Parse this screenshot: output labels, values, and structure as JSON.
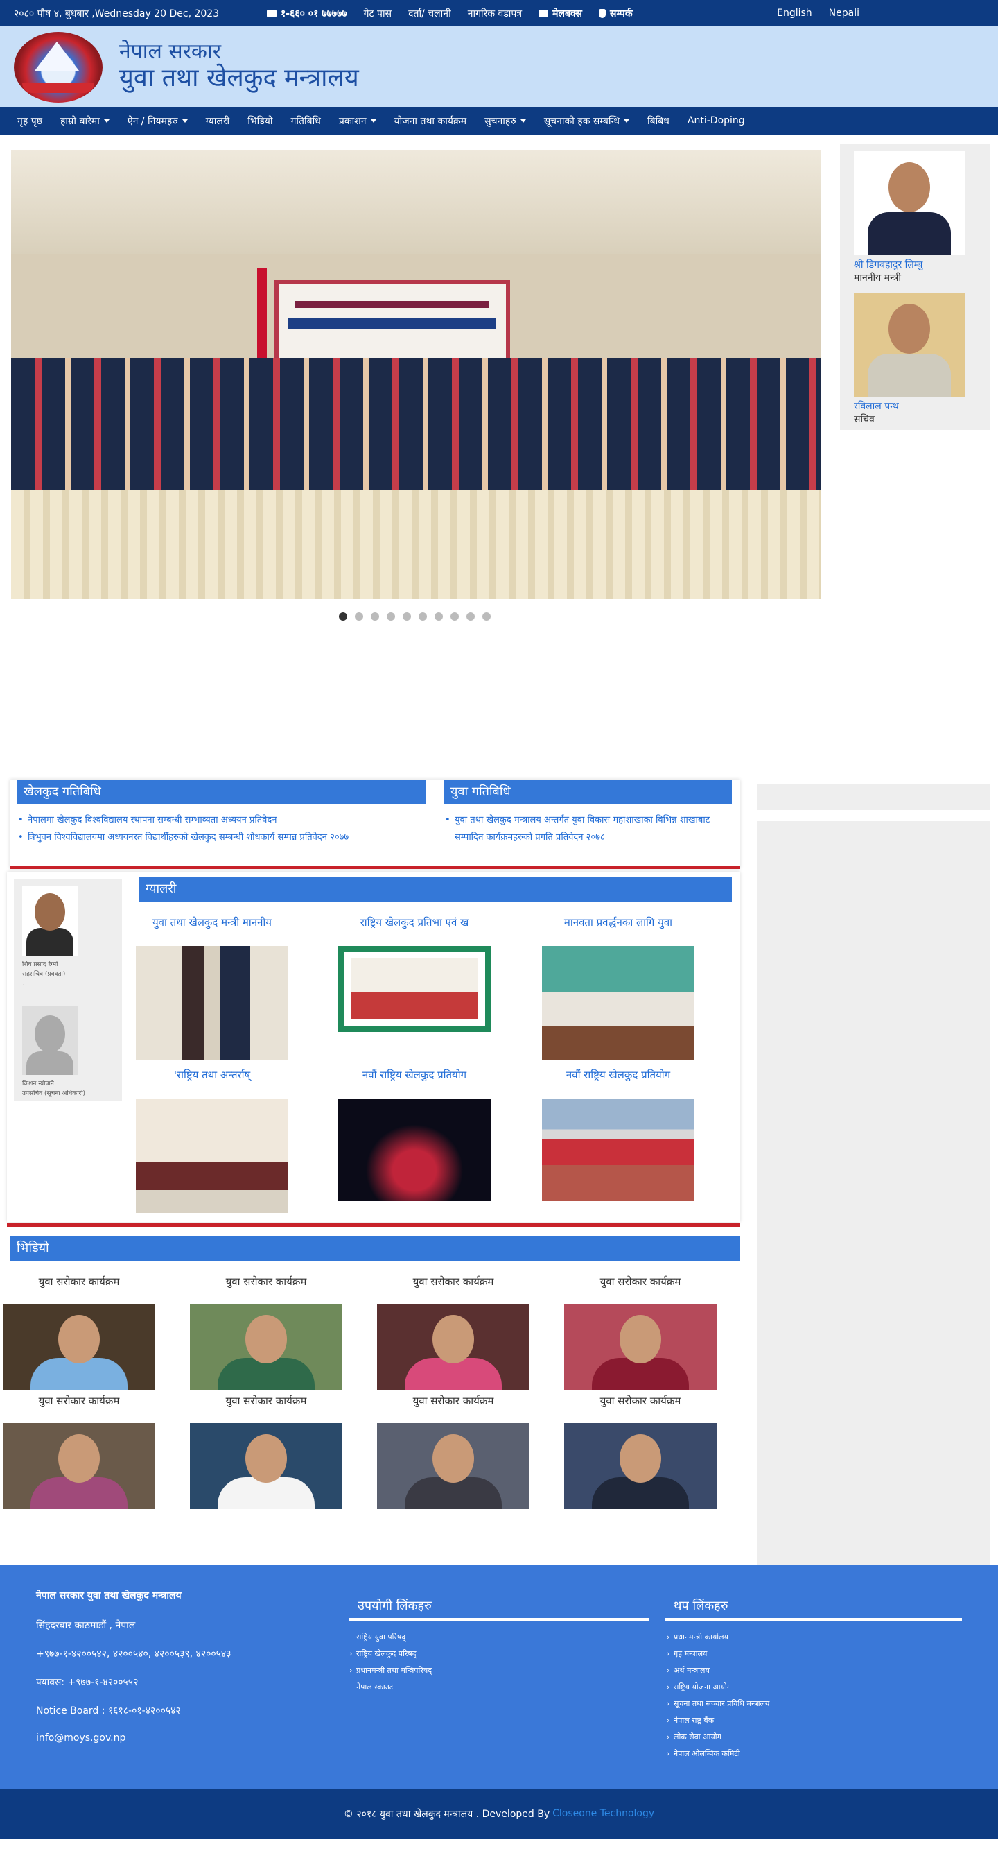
{
  "topbar": {
    "date": "२०८० पौष ४, बुधबार ,Wednesday 20 Dec, 2023",
    "links": [
      "१-६६० ०१ ७७७७७",
      "गेट पास",
      "दर्ता/ चलानी",
      "नागरिक वडापत्र",
      "मेलबक्स",
      "सम्पर्क"
    ],
    "lang_en": "English",
    "lang_np": "Nepali"
  },
  "header": {
    "title_small": "नेपाल सरकार",
    "title_large": "युवा तथा खेलकुद मन्त्रालय"
  },
  "nav": {
    "items": [
      {
        "label": "गृह पृष्ठ",
        "dropdown": false
      },
      {
        "label": "हाम्रो बारेमा",
        "dropdown": true
      },
      {
        "label": "ऐन / नियमहरु",
        "dropdown": true
      },
      {
        "label": "ग्यालरी",
        "dropdown": false
      },
      {
        "label": "भिडियो",
        "dropdown": false
      },
      {
        "label": "गतिबिधि",
        "dropdown": false
      },
      {
        "label": "प्रकाशन",
        "dropdown": true
      },
      {
        "label": "योजना तथा कार्यक्रम",
        "dropdown": false
      },
      {
        "label": "सुचनाहरु",
        "dropdown": true
      },
      {
        "label": "सूचनाको हक सम्बन्धि",
        "dropdown": true
      },
      {
        "label": "बिबिध",
        "dropdown": false
      },
      {
        "label": "Anti-Doping",
        "dropdown": false
      }
    ]
  },
  "slider": {
    "dot_count": 10,
    "active_dot": 0
  },
  "officials": [
    {
      "name": "श्री डिगबहादुर लिम्बु",
      "role": "माननीय मन्त्री"
    },
    {
      "name": "रविलाल पन्थ",
      "role": "सचिव"
    }
  ],
  "activities": {
    "sports": {
      "title": "खेलकुद गतिबिधि",
      "items": [
        "नेपालमा खेलकुद विश्वविद्यालय स्थापना सम्बन्धी सम्भाव्यता अध्ययन प्रतिवेदन",
        "त्रिभुवन विश्वविद्यालयमा अध्ययनरत विद्यार्थीहरुको खेलकुद सम्बन्धी शोधकार्य सम्पन्न प्रतिवेदन २०७७"
      ]
    },
    "youth": {
      "title": "युवा गतिबिधि",
      "items": [
        "युवा तथा खेलकुद मन्त्रालय अन्तर्गत युवा विकास महाशाखाका विभिन्न शाखाबाट सम्पादित कार्यक्रमहरुको प्रगति प्रतिवेदन २०७८"
      ]
    }
  },
  "info_officers": [
    {
      "name": "शिव प्रसाद रेग्मी",
      "role": "सहसचिव (प्रवक्ता)",
      "extra": "."
    },
    {
      "name": "किशन न्यौपाने",
      "role": "उपसचिव (सूचना अधिकारी)"
    }
  ],
  "gallery": {
    "title": "ग्यालरी",
    "items": [
      {
        "caption": "युवा तथा खेलकुद मन्त्री माननीय"
      },
      {
        "caption": "राष्ट्रिय खेलकुद प्रतिभा एवं ख"
      },
      {
        "caption": "मानवता प्रवर्द्धनका लागि युवा"
      },
      {
        "caption": "'राष्ट्रिय तथा अन्तर्राष्"
      },
      {
        "caption": "नवौं राष्ट्रिय खेलकुद प्रतियोग"
      },
      {
        "caption": "नवौं राष्ट्रिय खेलकुद प्रतियोग"
      }
    ]
  },
  "video": {
    "title": "भिडियो",
    "items": [
      {
        "caption": "युवा सरोकार कार्यक्रम"
      },
      {
        "caption": "युवा सरोकार कार्यक्रम"
      },
      {
        "caption": "युवा सरोकार कार्यक्रम"
      },
      {
        "caption": "युवा सरोकार कार्यक्रम"
      },
      {
        "caption": "युवा सरोकार कार्यक्रम"
      },
      {
        "caption": "युवा सरोकार कार्यक्रम"
      },
      {
        "caption": "युवा सरोकार कार्यक्रम"
      },
      {
        "caption": "युवा सरोकार कार्यक्रम"
      }
    ]
  },
  "footer": {
    "org": "नेपाल सरकार युवा तथा खेलकुद मन्त्रालय",
    "address": "सिंहदरबार काठमाडौं , नेपाल",
    "phone": "+९७७-१-४२००५४२, ४२००५४०, ४२००५३९, ४२००५४३",
    "fax": "फ्याक्स: +९७७-१-४२००५५२",
    "notice": "Notice Board : १६१८-०१-४२००५४२",
    "email": "info@moys.gov.np",
    "useful_title": "उपयोगी लिंकहरु",
    "useful_links": [
      {
        "label": "राष्ट्रिय युवा परिषद्",
        "bullet": false
      },
      {
        "label": "राष्ट्रिय खेलकुद परिषद्",
        "bullet": true
      },
      {
        "label": "प्रधानमन्त्री तथा मन्त्रिपरिषद्",
        "bullet": true
      },
      {
        "label": "नेपाल स्काउट",
        "bullet": false
      }
    ],
    "more_title": "थप लिंकहरु",
    "more_links": [
      "प्रधानमन्त्री कार्यालय",
      "गृह मन्त्रालय",
      "अर्थ मन्त्रालय",
      "राष्ट्रिय योजना आयोग",
      "सूचना तथा सञ्चार प्रविधि मन्त्रालय",
      "नेपाल राष्ट्र बैंक",
      "लोक सेवा आयोग",
      "नेपाल ओलम्पिक कमिटी"
    ]
  },
  "copyright": {
    "text": "© २०१८ युवा तथा खेलकुद मन्त्रालय . Developed By",
    "developer": "Closeone Technology"
  }
}
